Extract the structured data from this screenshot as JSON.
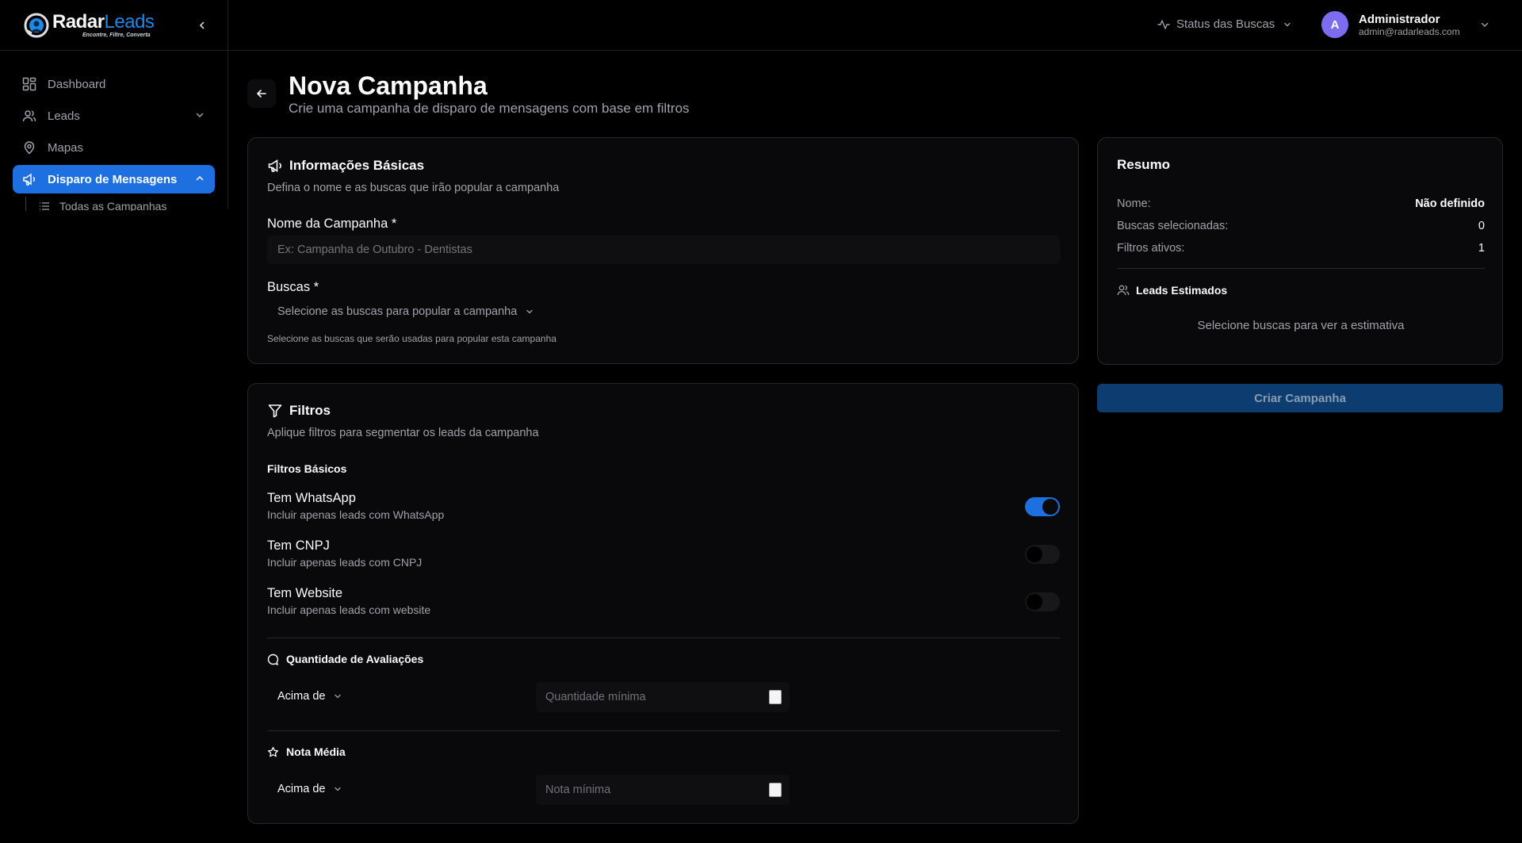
{
  "brand": {
    "name_part1": "Radar",
    "name_part2": "Leads",
    "tagline": "Encontre, Filtre, Converta"
  },
  "sidebar": {
    "items": [
      {
        "label": "Dashboard",
        "icon": "dashboard-icon"
      },
      {
        "label": "Leads",
        "icon": "users-icon"
      },
      {
        "label": "Mapas",
        "icon": "map-pin-icon"
      },
      {
        "label": "Disparo de Mensagens",
        "icon": "megaphone-icon",
        "active": true
      }
    ],
    "subitems": [
      {
        "label": "Todas as Campanhas",
        "icon": "list-icon"
      }
    ]
  },
  "header": {
    "status_label": "Status das Buscas",
    "user": {
      "initial": "A",
      "name": "Administrador",
      "email": "admin@radarleads.com"
    }
  },
  "page": {
    "title": "Nova Campanha",
    "subtitle": "Crie uma campanha de disparo de mensagens com base em filtros"
  },
  "basic": {
    "title": "Informações Básicas",
    "desc": "Defina o nome e as buscas que irão popular a campanha",
    "name_label": "Nome da Campanha *",
    "name_placeholder": "Ex: Campanha de Outubro - Dentistas",
    "name_value": "",
    "searches_label": "Buscas *",
    "searches_placeholder": "Selecione as buscas para popular a campanha",
    "searches_hint": "Selecione as buscas que serão usadas para popular esta campanha"
  },
  "filters": {
    "title": "Filtros",
    "desc": "Aplique filtros para segmentar os leads da campanha",
    "basic_title": "Filtros Básicos",
    "toggles": [
      {
        "title": "Tem WhatsApp",
        "desc": "Incluir apenas leads com WhatsApp",
        "on": true
      },
      {
        "title": "Tem CNPJ",
        "desc": "Incluir apenas leads com CNPJ",
        "on": false
      },
      {
        "title": "Tem Website",
        "desc": "Incluir apenas leads com website",
        "on": false
      }
    ],
    "reviews": {
      "title": "Quantidade de Avaliações",
      "operator": "Acima de",
      "placeholder": "Quantidade mínima"
    },
    "rating": {
      "title": "Nota Média",
      "operator": "Acima de",
      "placeholder": "Nota mínima"
    }
  },
  "summary": {
    "title": "Resumo",
    "rows": [
      {
        "label": "Nome:",
        "value": "Não definido"
      },
      {
        "label": "Buscas selecionadas:",
        "value": "0"
      },
      {
        "label": "Filtros ativos:",
        "value": "1"
      }
    ],
    "leads_title": "Leads Estimados",
    "leads_hint": "Selecione buscas para ver a estimativa"
  },
  "actions": {
    "create_label": "Criar Campanha"
  },
  "colors": {
    "accent": "#1e6fe0",
    "avatar": "#7c6cf0",
    "create_button": "#0d3d70"
  }
}
